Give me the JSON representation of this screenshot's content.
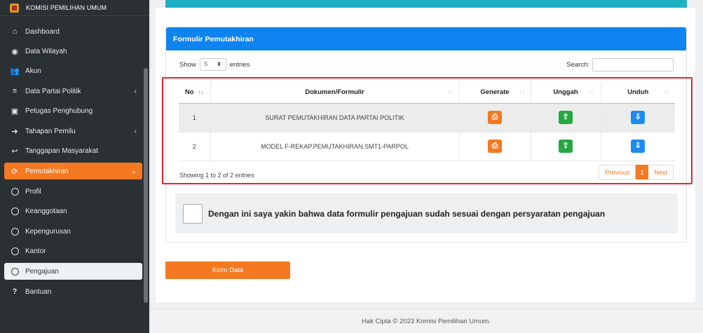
{
  "sidebar": {
    "brand": "KOMISI PEMILIHAN UMUM",
    "items": [
      {
        "label": "Dashboard",
        "icon": "home-icon",
        "glyph": "🏠"
      },
      {
        "label": "Data Wilayah",
        "icon": "globe-icon",
        "glyph": "🌐"
      },
      {
        "label": "Akun",
        "icon": "users-icon",
        "glyph": "👥"
      },
      {
        "label": "Data Partai Politik",
        "icon": "database-icon",
        "glyph": "≣"
      },
      {
        "label": "Petugas Penghubung",
        "icon": "id-card-icon",
        "glyph": "▣"
      },
      {
        "label": "Tahapan Pemilu",
        "icon": "sign-in-icon",
        "glyph": "➜"
      },
      {
        "label": "Tanggapan Masyarakat",
        "icon": "reply-icon",
        "glyph": "↩"
      },
      {
        "label": "Pemutakhiran",
        "icon": "refresh-icon",
        "glyph": "⟳"
      },
      {
        "label": "Profil"
      },
      {
        "label": "Keanggotaan"
      },
      {
        "label": "Kepengurusan"
      },
      {
        "label": "Kantor"
      },
      {
        "label": "Pengajuan"
      },
      {
        "label": "Bantuan",
        "icon": "question-icon",
        "glyph": "?"
      }
    ]
  },
  "card": {
    "title": "Formulir Pemutakhiran",
    "show_label": "Show",
    "length_value": "5",
    "entries_label": "entries",
    "search_label": "Search:",
    "columns": [
      "No",
      "Dokumen/Formulir",
      "Generate",
      "Unggah",
      "Unduh"
    ],
    "rows": [
      {
        "no": "1",
        "doc": "SURAT PEMUTAKHIRAN DATA PARTAI POLITIK"
      },
      {
        "no": "2",
        "doc": "MODEL F-REKAP.PEMUTAKHIRAN.SMT1-PARPOL"
      }
    ],
    "info": "Showing 1 to 2 of 2 entries",
    "pager": {
      "previous": "Previous",
      "current": "1",
      "next": "Next"
    },
    "confirm_text": "Dengan ini saya yakin bahwa data formulir pengajuan sudah sesuai dengan persyaratan pengajuan"
  },
  "submit_label": "Kirim Data",
  "footer": "Hak Cipta © 2023 Komisi Pemilihan Umum.",
  "colors": {
    "accent": "#f47920",
    "header_blue": "#0e84f1",
    "green": "#24a83f",
    "blue": "#1d8cf0",
    "highlight": "#e8232b"
  }
}
